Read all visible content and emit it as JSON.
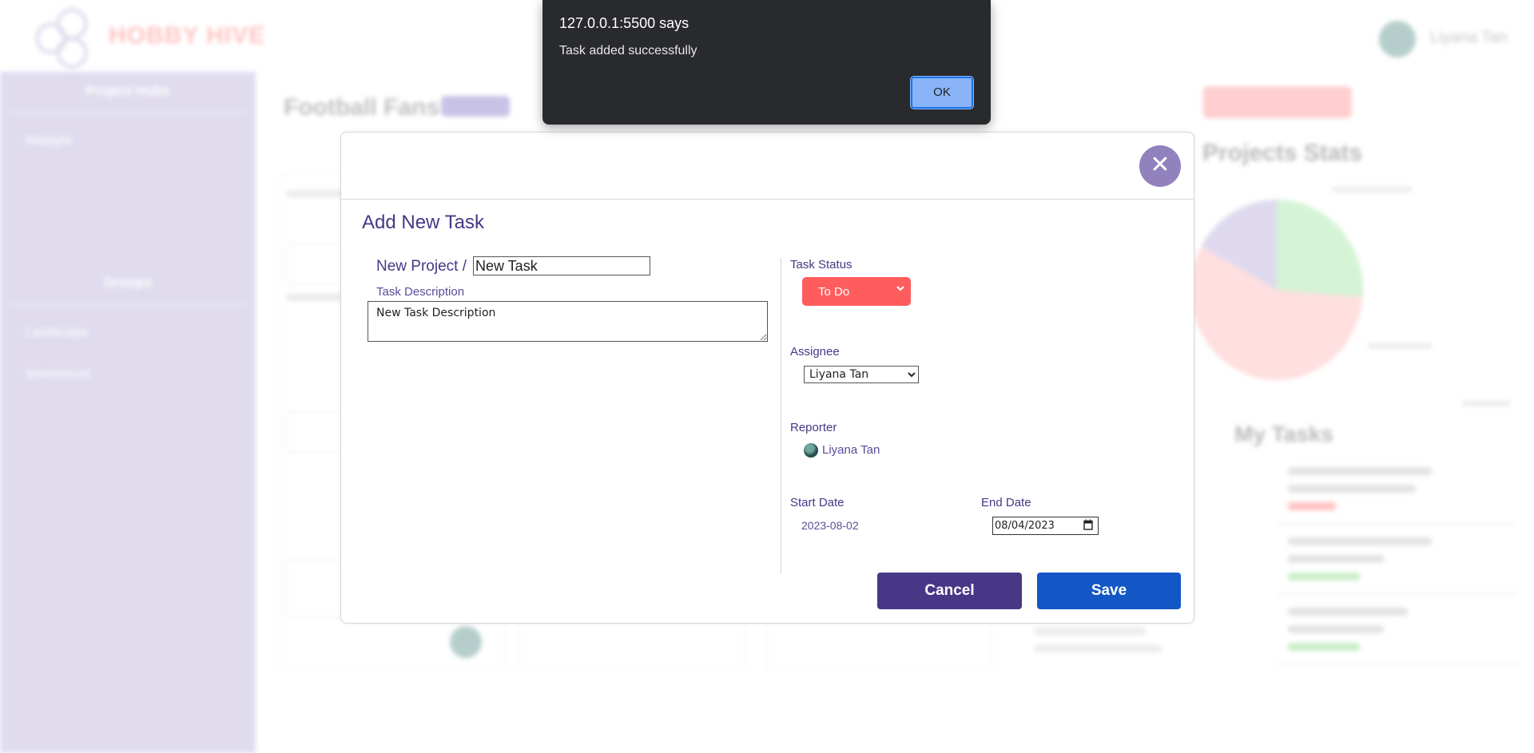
{
  "background": {
    "app_name": "HOBBY HIVE",
    "user_name": "Liyana Tan",
    "sidebar": {
      "section1": "Project Hubs",
      "item1": "Weblyfe",
      "section2": "Groups",
      "item2": "Landscape",
      "item3": "Wanderlust"
    },
    "project_title": "Football Fans",
    "stats_title": "Projects Stats",
    "my_tasks_title": "My Tasks"
  },
  "alert": {
    "title": "127.0.0.1:5500 says",
    "message": "Task added successfully",
    "ok_label": "OK"
  },
  "modal": {
    "close_symbol": "✕",
    "title": "Add New Task",
    "project_prefix": "New Project /",
    "task_name": "New Task",
    "description_label": "Task Description",
    "description": "New Task Description",
    "status_label": "Task Status",
    "status_value": "To Do",
    "assignee_label": "Assignee",
    "assignee_value": "Liyana Tan",
    "reporter_label": "Reporter",
    "reporter_name": "Liyana Tan",
    "start_date_label": "Start Date",
    "start_date": "2023-08-02",
    "end_date_label": "End Date",
    "end_date": "08/04/2023",
    "cancel_label": "Cancel",
    "save_label": "Save"
  },
  "colors": {
    "primary": "#483787",
    "save_blue": "#1257c5",
    "status_red": "#ff5d5d",
    "sidebar": "#b5acd6"
  }
}
